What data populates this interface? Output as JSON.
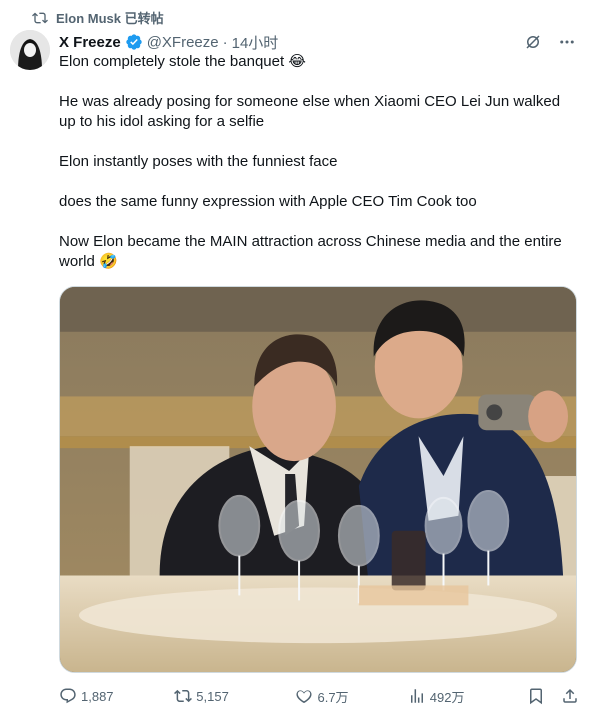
{
  "repost": {
    "label": "Elon Musk 已转帖",
    "icon": "repost-icon"
  },
  "author": {
    "name": "X Freeze",
    "handle": "@XFreeze",
    "separator": "·",
    "time": "14小时",
    "verified_color": "#1d9bf0"
  },
  "tweet": {
    "paragraphs": [
      "Elon completely stole the banquet 😂",
      "He was already posing for someone else when Xiaomi CEO Lei Jun walked up to his idol asking for a selfie",
      "Elon instantly poses with the funniest face",
      "does the same funny expression with Apple CEO Tim Cook too",
      "Now Elon became the MAIN attraction across Chinese media and the entire world 🤣"
    ]
  },
  "actions": {
    "reply_count": "1,887",
    "repost_count": "5,157",
    "like_count": "6.7万",
    "view_count": "492万"
  },
  "colors": {
    "text": "#0f1419",
    "muted": "#536471",
    "border": "#cfd9de"
  }
}
